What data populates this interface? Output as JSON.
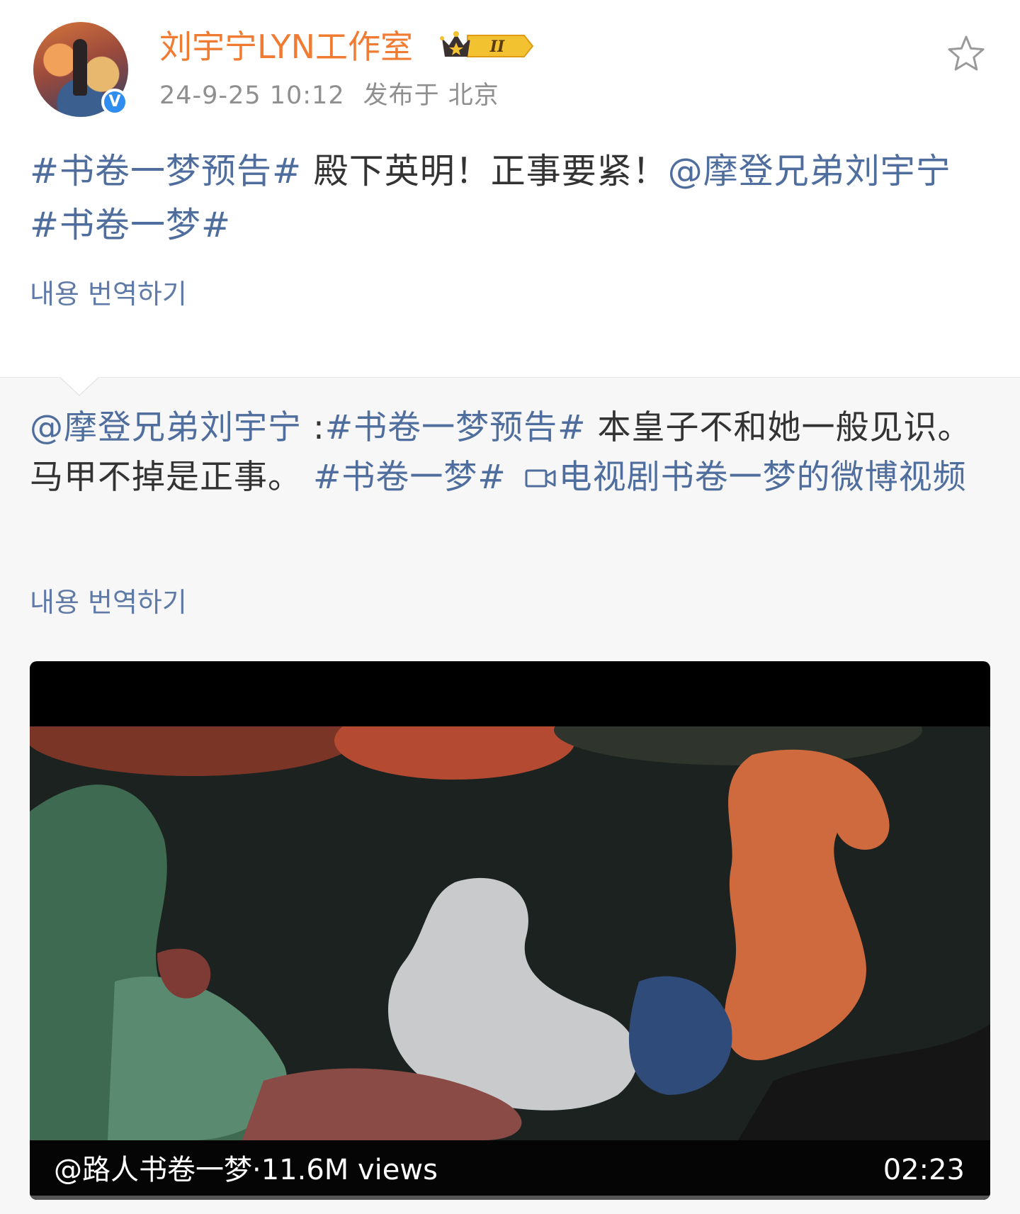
{
  "post": {
    "author": "刘宇宁LYN工作室",
    "badge_level": "II",
    "timestamp": "24-9-25 10:12",
    "location": "发布于 北京",
    "text": {
      "tag1": "#书卷一梦预告#",
      "body": " 殿下英明！正事要紧！",
      "mention": "@摩登兄弟刘宇宁",
      "tag2": "#书卷一梦#"
    },
    "translate_label": "내용 번역하기"
  },
  "retweet": {
    "mention": "@摩登兄弟刘宇宁",
    "separator": " :",
    "tag1": "#书卷一梦预告#",
    "body": " 本皇子不和她一般见识。马甲不掉是正事。",
    "tag2": "#书卷一梦#",
    "video_link": "电视剧书卷一梦的微博视频",
    "translate_label": "내용 번역하기"
  },
  "video": {
    "source_label": "@路人书卷一梦·11.6M views",
    "duration": "02:23",
    "colors": {
      "background": "#1c221f",
      "letterbox": "#000000"
    }
  },
  "icons": {
    "favorite": "star-outline-icon",
    "verified": "verified-v-icon",
    "crown": "crown-badge-icon",
    "video_link": "video-camera-icon"
  },
  "colors": {
    "username": "#f07c33",
    "link": "#4f6e9e",
    "translate": "#5f7aa6",
    "meta": "#8f8f8f"
  }
}
